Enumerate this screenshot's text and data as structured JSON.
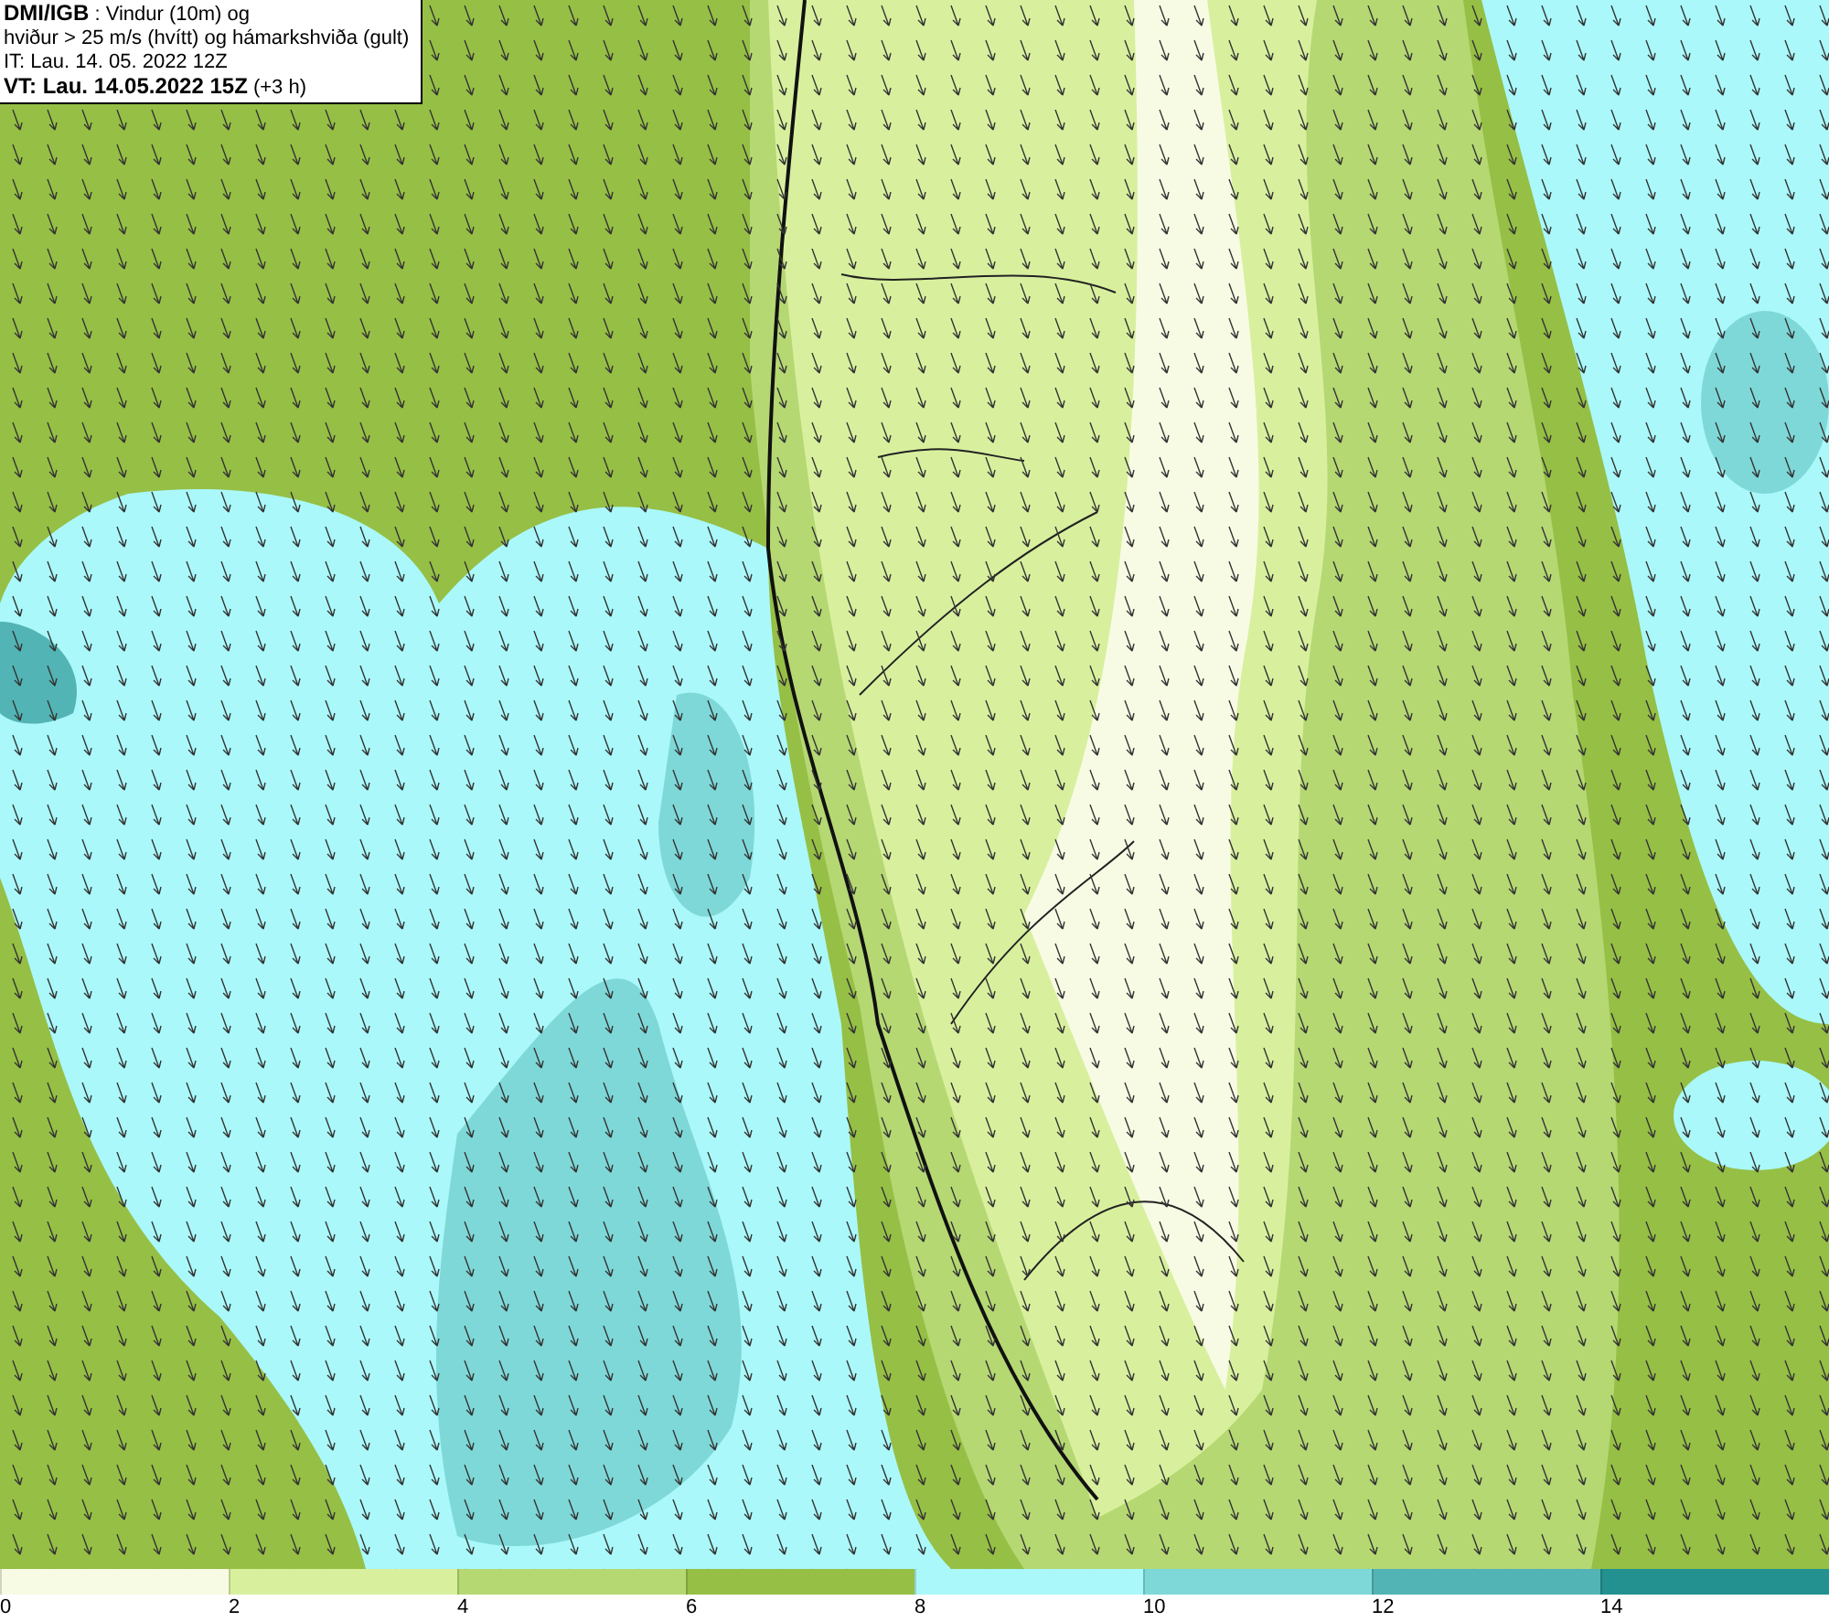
{
  "info_box": {
    "lines": [
      "**DMI/IGB** : Vindur (10m) og",
      "hviður > 25 m/s (hvítt) og hámarkshviða (gult)",
      "IT: Lau. 14. 05. 2022 12Z",
      "**VT: Lau. 14.05.2022 15Z** (+3 h)"
    ]
  },
  "legend": {
    "bins": [
      {
        "label": "0",
        "color": "#f7fbe4"
      },
      {
        "label": "2",
        "color": "#d8f09e"
      },
      {
        "label": "4",
        "color": "#b5d873"
      },
      {
        "label": "6",
        "color": "#96bf45"
      },
      {
        "label": "8",
        "color": "#aaf8fa"
      },
      {
        "label": "10",
        "color": "#7fd8d8"
      },
      {
        "label": "12",
        "color": "#52b4b4"
      },
      {
        "label": "14",
        "color": "#23918f"
      }
    ]
  }
}
